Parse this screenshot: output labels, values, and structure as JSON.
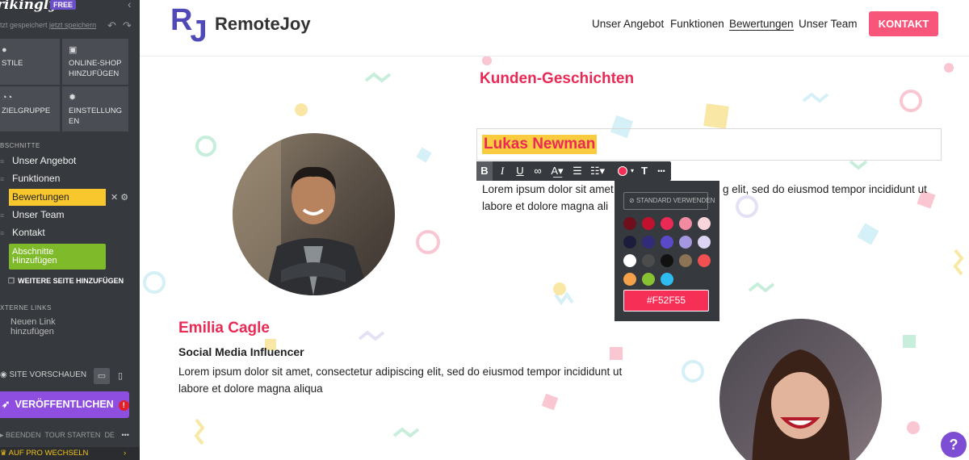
{
  "editor": {
    "brand": "rikingly",
    "badge": "FREE",
    "saved_text": "tzt gespeichert",
    "save_now": "jetzt speichern",
    "tiles": {
      "styles": "STILE",
      "shop": "ONLINE-SHOP HINZUFÜGEN",
      "audience": "ZIELGRUPPE",
      "settings_1": "EINSTELLUNG",
      "settings_2": "EN"
    },
    "sections_heading": "BSCHNITTE",
    "sections": [
      {
        "label": "Unser Angebot"
      },
      {
        "label": "Funktionen"
      },
      {
        "label": "Bewertungen"
      },
      {
        "label": "Unser Team"
      },
      {
        "label": "Kontakt"
      }
    ],
    "add_section_1": "Abschnitte",
    "add_section_2": "Hinzufügen",
    "more_page": "WEITERE SEITE HINZUFÜGEN",
    "external_links": "XTERNE LINKS",
    "new_link_1": "Neuen Link",
    "new_link_2": "hinzufügen",
    "preview": "SITE VORSCHAUEN",
    "publish": "VERÖFFENTLICHEN",
    "footer": {
      "end": "BEENDEN",
      "tour": "TOUR STARTEN",
      "lang": "DE"
    },
    "pro": "AUF PRO WECHSELN"
  },
  "site": {
    "logo_letters": {
      "r": "R",
      "j": "J"
    },
    "logo_text": "RemoteJoy",
    "nav": [
      {
        "label": "Unser Angebot"
      },
      {
        "label": "Funktionen"
      },
      {
        "label": "Bewertungen"
      },
      {
        "label": "Unser Team"
      }
    ],
    "cta": "KONTAKT",
    "section_title": "Kunden-Geschichten",
    "person1": {
      "name": "Lukas Newman",
      "text_1": "Lorem ipsum dolor sit amet",
      "text_1b": "g elit, sed do eiusmod tempor incididunt ut",
      "text_2": "labore et dolore magna ali"
    },
    "person2": {
      "name": "Emilia Cagle",
      "role": "Social Media Influencer",
      "text_1": "Lorem ipsum dolor sit amet, consectetur adipiscing elit, sed do eiusmod tempor incididunt ut",
      "text_2": "labore et dolore magna aliqua"
    }
  },
  "picker": {
    "default": "STANDARD VERWENDEN",
    "hex": "#F52F55",
    "swatches": [
      "#6d0f1d",
      "#c0122f",
      "#ea2a55",
      "#f28ba2",
      "#f8d4db",
      "#1b1d3a",
      "#302c78",
      "#5a4ac7",
      "#a596e0",
      "#dcd4f2",
      "#ffffff",
      "#4c4c4c",
      "#111111",
      "#8c7355",
      "#f05050",
      "#f5a04a",
      "#86c232",
      "#2ebcf0"
    ]
  },
  "toolbar": {
    "bold": "B",
    "italic": "I",
    "underline": "U",
    "more": "•••"
  },
  "help": "?"
}
